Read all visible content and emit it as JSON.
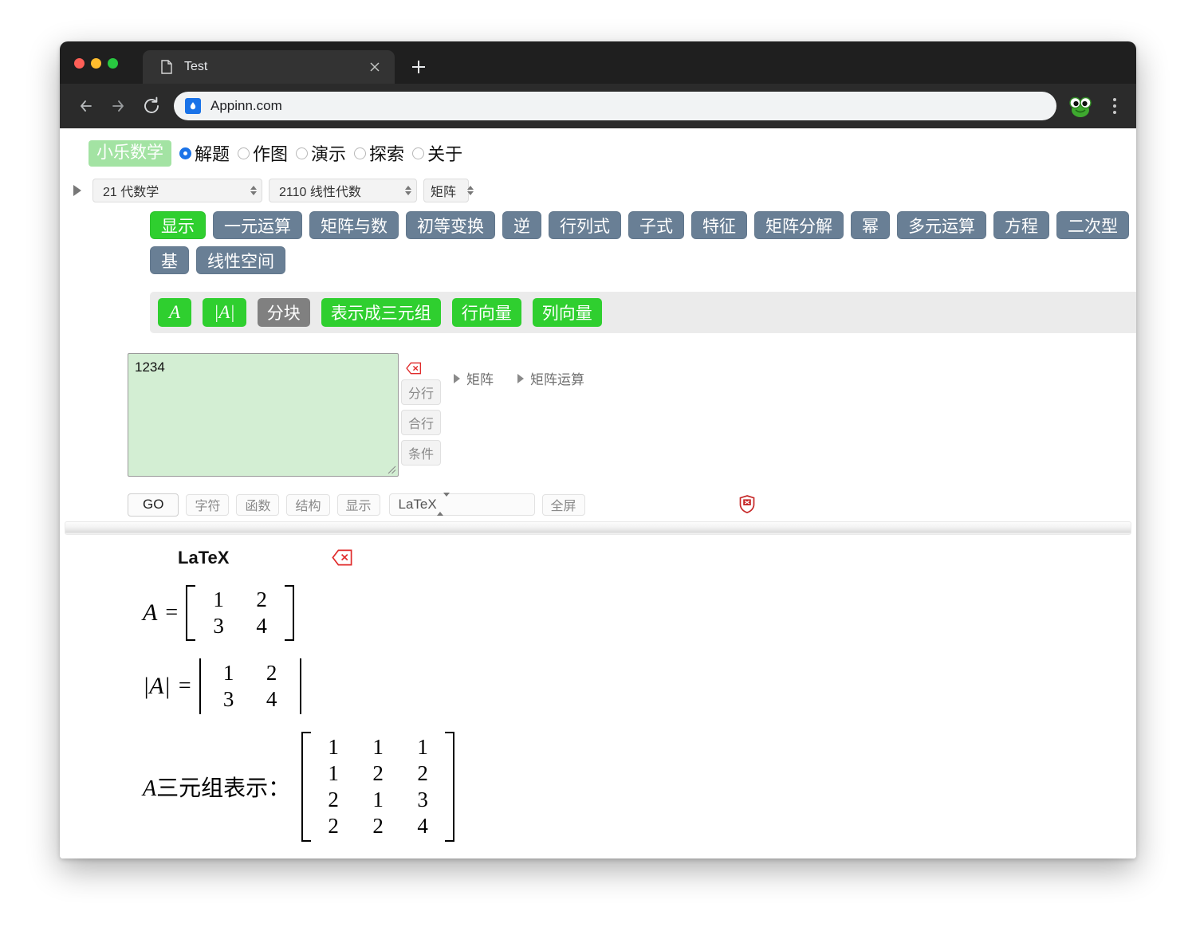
{
  "browser": {
    "tab": {
      "title": "Test",
      "favicon_icon": "document-icon",
      "close_icon": "close-icon"
    },
    "new_tab_icon": "plus-icon",
    "nav": {
      "back_icon": "arrow-left-icon",
      "forward_icon": "arrow-right-icon",
      "reload_icon": "reload-icon"
    },
    "omnibox": {
      "url": "Appinn.com",
      "site_icon": "droplet-icon"
    },
    "extension_icon": "frog-extension-icon",
    "menu_icon": "kebab-menu-icon"
  },
  "app": {
    "logo": "小乐数学",
    "logo_bg": "#a3e3a3",
    "modes": [
      {
        "label": "解题",
        "selected": true
      },
      {
        "label": "作图",
        "selected": false
      },
      {
        "label": "演示",
        "selected": false
      },
      {
        "label": "探索",
        "selected": false
      },
      {
        "label": "关于",
        "selected": false
      }
    ],
    "tree_toggle_icon": "triangle-right-icon",
    "selects": [
      {
        "name": "subject",
        "value": "21 代数学"
      },
      {
        "name": "topic",
        "value": "2110 线性代数"
      },
      {
        "name": "object",
        "value": "矩阵"
      }
    ],
    "categories": [
      {
        "label": "显示",
        "active": true
      },
      {
        "label": "一元运算",
        "active": false
      },
      {
        "label": "矩阵与数",
        "active": false
      },
      {
        "label": "初等变换",
        "active": false
      },
      {
        "label": "逆",
        "active": false
      },
      {
        "label": "行列式",
        "active": false
      },
      {
        "label": "子式",
        "active": false
      },
      {
        "label": "特征",
        "active": false
      },
      {
        "label": "矩阵分解",
        "active": false
      },
      {
        "label": "幂",
        "active": false
      },
      {
        "label": "多元运算",
        "active": false
      },
      {
        "label": "方程",
        "active": false
      },
      {
        "label": "二次型",
        "active": false
      },
      {
        "label": "基",
        "active": false
      },
      {
        "label": "线性空间",
        "active": false
      }
    ],
    "operations": [
      {
        "label": "A",
        "style": "math",
        "active": true
      },
      {
        "label": "|A|",
        "style": "math",
        "active": true
      },
      {
        "label": "分块",
        "style": "text",
        "active": false
      },
      {
        "label": "表示成三元组",
        "style": "text",
        "active": true
      },
      {
        "label": "行向量",
        "style": "text",
        "active": true
      },
      {
        "label": "列向量",
        "style": "text",
        "active": true
      }
    ],
    "active_color": "#2fcf2f",
    "inactive_color": "#697f95",
    "gray_color": "#808080"
  },
  "editor": {
    "textarea_value": "1234",
    "textarea_placeholder": "",
    "erase_icon": "erase-backspace-icon",
    "side_buttons": [
      {
        "label": "分行"
      },
      {
        "label": "合行"
      },
      {
        "label": "条件"
      }
    ],
    "tree_links": [
      {
        "label": "矩阵",
        "icon": "triangle-right-icon"
      },
      {
        "label": "矩阵运算",
        "icon": "triangle-right-icon"
      }
    ]
  },
  "bottom_toolbar": {
    "go_label": "GO",
    "buttons": [
      {
        "label": "字符"
      },
      {
        "label": "函数"
      },
      {
        "label": "结构"
      },
      {
        "label": "显示"
      }
    ],
    "format_value": "LaTeX",
    "fullscreen_label": "全屏",
    "shield_icon": "shield-block-icon"
  },
  "results": {
    "title": "LaTeX",
    "erase_icon": "erase-backspace-icon",
    "rows": [
      {
        "name": "matrix-A",
        "lhs": "A",
        "eq": "=",
        "bracket": "square",
        "cols": 2,
        "cells": [
          "1",
          "2",
          "3",
          "4"
        ]
      },
      {
        "name": "determinant-A",
        "lhs": "|A|",
        "eq": "=",
        "bracket": "vertical",
        "cols": 2,
        "cells": [
          "1",
          "2",
          "3",
          "4"
        ]
      },
      {
        "name": "triple-representation",
        "label_prefix": "A",
        "label_rest": "三元组表示：",
        "bracket": "square",
        "cols": 3,
        "cells": [
          "1",
          "1",
          "1",
          "1",
          "2",
          "2",
          "2",
          "1",
          "3",
          "2",
          "2",
          "4"
        ]
      }
    ]
  }
}
